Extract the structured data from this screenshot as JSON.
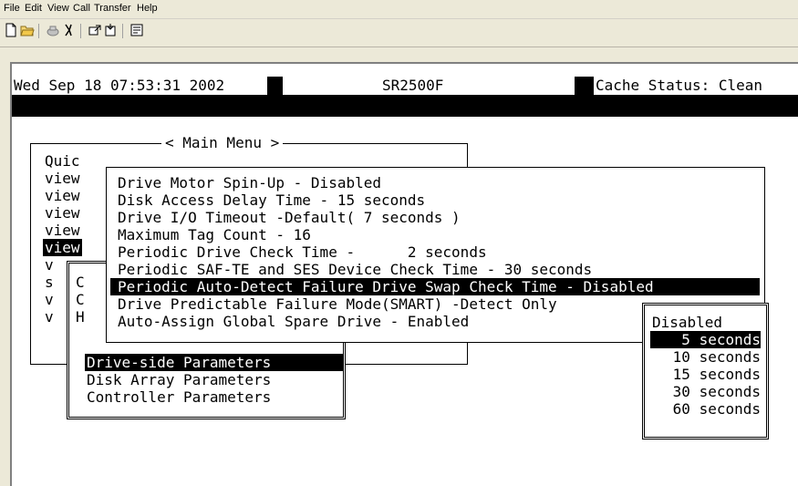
{
  "menubar": {
    "items": [
      "File",
      "Edit",
      "View",
      "Call",
      "Transfer",
      "Help"
    ]
  },
  "toolbar": {
    "icons": [
      "new-icon",
      "open-icon",
      "disconnect-icon",
      "properties-phone-icon",
      "send-icon",
      "receive-icon",
      "properties-icon"
    ]
  },
  "status": {
    "datetime": "Wed Sep 18 07:53:31 2002",
    "model": "SR2500F",
    "cache": "Cache Status: Clean"
  },
  "main_menu": {
    "title": "< Main Menu >",
    "items": [
      "Quic",
      "view",
      "view",
      "view",
      "view",
      "view",
      "v",
      "s",
      "v",
      "v"
    ],
    "sub_prefix": [
      "C",
      "C",
      "H"
    ]
  },
  "drive_params": {
    "items": [
      "Drive Motor Spin-Up - Disabled",
      "Disk Access Delay Time - 15 seconds",
      "Drive I/O Timeout -Default( 7 seconds )",
      "Maximum Tag Count - 16",
      "Periodic Drive Check Time -      2 seconds",
      "Periodic SAF-TE and SES Device Check Time - 30 seconds",
      "Periodic Auto-Detect Failure Drive Swap Check Time - Disabled",
      "Drive Predictable Failure Mode(SMART) -Detect Only",
      "Auto-Assign Global Spare Drive - Enabled"
    ],
    "selected_index": 6
  },
  "config_menu": {
    "items": [
      "Drive-side Parameters",
      "Disk Array Parameters",
      "Controller Parameters"
    ],
    "selected_index": 0
  },
  "interval_options": {
    "items": [
      "Disabled",
      "5 seconds",
      "10 seconds",
      "15 seconds",
      "30 seconds",
      "60 seconds"
    ],
    "selected_index": 1
  }
}
